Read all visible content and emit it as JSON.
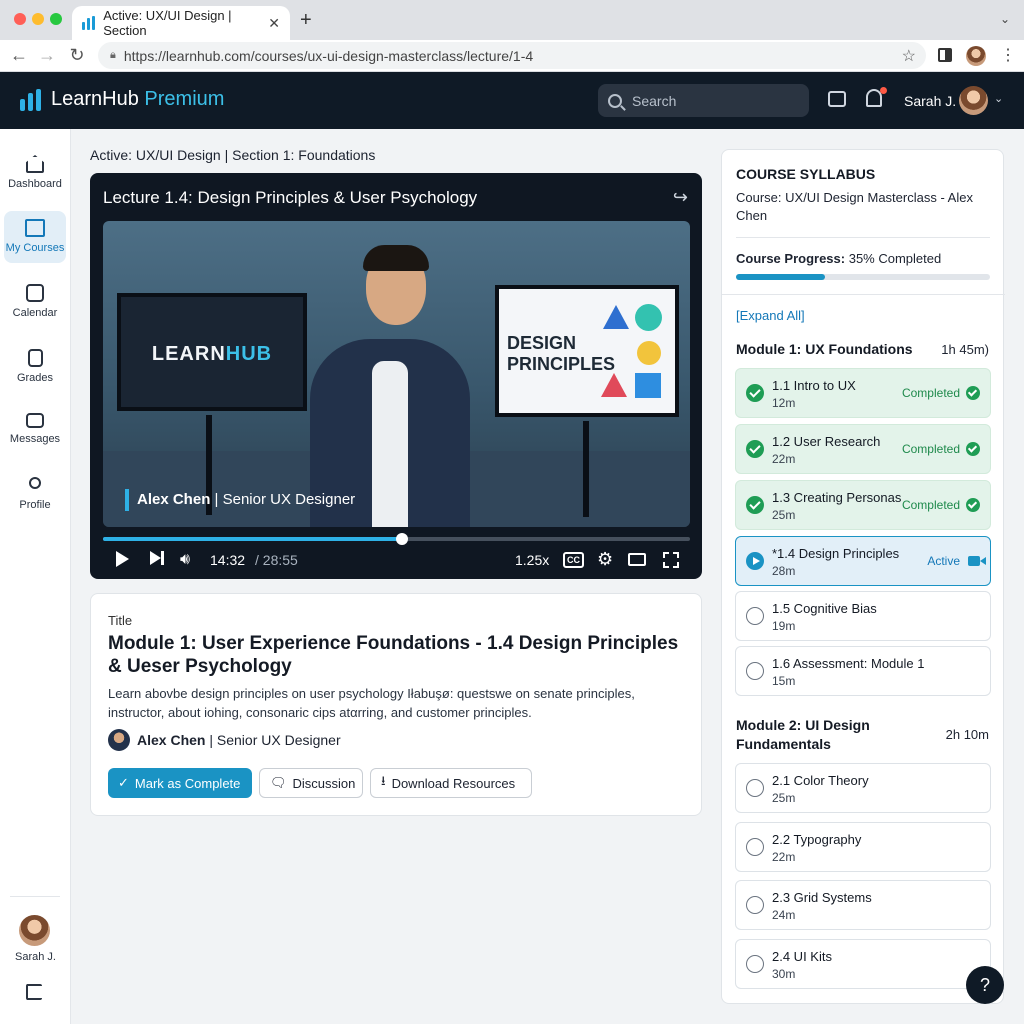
{
  "browser": {
    "tab_title": "Active: UX/UI Design | Section",
    "url": "https://learnhub.com/courses/ux-ui-design-masterclass/lecture/1-4"
  },
  "header": {
    "brand": "LearnHub",
    "brand_suffix": "Premium",
    "search_placeholder": "Search",
    "user_name": "Sarah J."
  },
  "sidebar": {
    "items": [
      {
        "label": "Dashboard",
        "icon": "home-icon"
      },
      {
        "label": "My Courses",
        "icon": "book-icon"
      },
      {
        "label": "Calendar",
        "icon": "calendar-icon"
      },
      {
        "label": "Grades",
        "icon": "document-icon"
      },
      {
        "label": "Messages",
        "icon": "mail-icon"
      },
      {
        "label": "Profile",
        "icon": "person-icon"
      }
    ],
    "user_name": "Sarah J."
  },
  "main": {
    "breadcrumb": "Active: UX/UI Design | Section 1: Foundations",
    "video": {
      "lecture_title": "Lecture 1.4: Design Principles & User Psychology",
      "left_screen_brand_a": "LEARN",
      "left_screen_brand_b": "HUB",
      "right_screen_line1": "DESIGN",
      "right_screen_line2": "PRINCIPLES",
      "presenter_name": "Alex Chen",
      "presenter_role": "Senior UX Designer",
      "time_current": "14:32",
      "time_total": "/ 28:55",
      "progress": 0.51,
      "speed": "1.25x",
      "cc_label": "CC"
    },
    "info": {
      "kicker": "Title",
      "title": "Module 1: User Experience Foundations - 1.4 Design Principles & Ueser Psychology",
      "description": "Learn abovbe design principles on user psychology Iłabuşø: questswe on senate principles, instructor, about iohing, consonaric cips atαrring, and customer principles.",
      "author_name": "Alex Chen",
      "author_role": "Senior UX Designer",
      "btn_complete": "Mark as Complete",
      "btn_discussion": "Discussion",
      "btn_download": "Download Resources"
    }
  },
  "syllabus": {
    "heading": "COURSE SYLLABUS",
    "course": "Course: UX/UI Design Masterclass - Alex Chen",
    "progress_label": "Course Progress:",
    "progress_text": "35% Completed",
    "progress": 0.35,
    "expand_all": "[Expand All]",
    "modules": [
      {
        "title": "Module 1: UX Foundations",
        "duration": "1h 45m)",
        "lessons": [
          {
            "name": "1.1 Intro to UX",
            "duration": "12m",
            "status": "Completed"
          },
          {
            "name": "1.2 User Research",
            "duration": "22m",
            "status": "Completed"
          },
          {
            "name": "1.3 Creating Personas",
            "duration": "25m",
            "status": "Completed"
          },
          {
            "name": "*1.4 Design Principles",
            "duration": "28m",
            "status": "Active"
          },
          {
            "name": "1.5 Cognitive Bias",
            "duration": "19m",
            "status": ""
          },
          {
            "name": "1.6 Assessment: Module 1",
            "duration": "15m",
            "status": ""
          }
        ]
      },
      {
        "title": "Module 2: UI Design Fundamentals",
        "duration": "2h 10m",
        "lessons": [
          {
            "name": "2.1 Color Theory",
            "duration": "25m",
            "status": ""
          },
          {
            "name": "2.2 Typography",
            "duration": "22m",
            "status": ""
          },
          {
            "name": "2.3 Grid Systems",
            "duration": "24m",
            "status": ""
          },
          {
            "name": "2.4 UI Kits",
            "duration": "30m",
            "status": ""
          }
        ]
      }
    ]
  },
  "help_label": "?",
  "colors": {
    "accent": "#1a93c4",
    "header_bg": "#0f1a26",
    "success": "#1f9d55"
  }
}
